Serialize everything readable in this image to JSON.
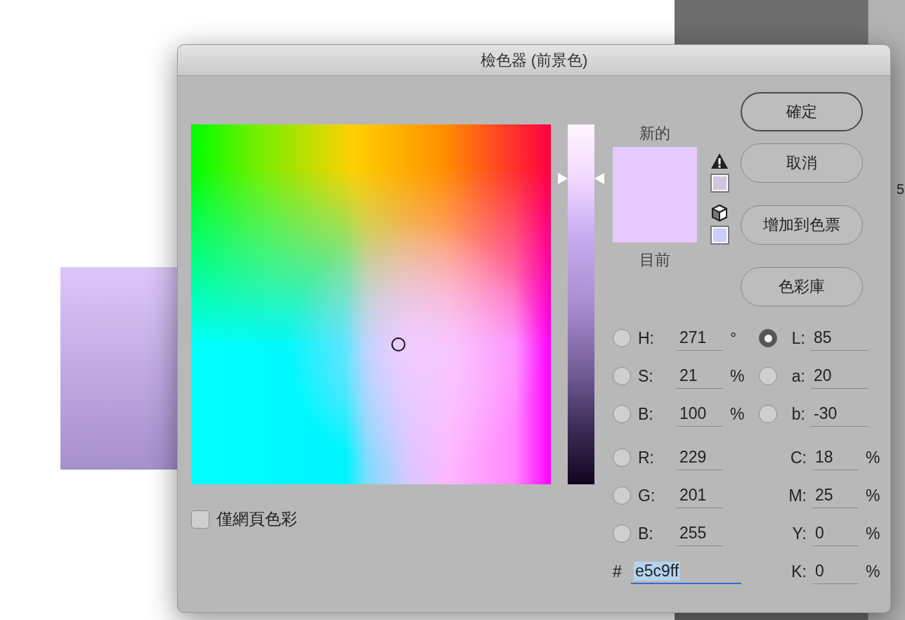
{
  "background": {
    "panel_text": "5"
  },
  "dialog": {
    "title": "檢色器 (前景色)",
    "lightness_slider": {
      "level": 0.85
    },
    "new_label": "新的",
    "current_label": "目前",
    "buttons": [
      {
        "label": "確定",
        "default": true
      },
      {
        "label": "取消",
        "default": false
      },
      {
        "label": "增加到色票",
        "default": false
      },
      {
        "label": "色彩庫",
        "default": false
      }
    ],
    "web_colors_only": {
      "label": "僅網頁色彩",
      "checked": false
    },
    "hsb": [
      {
        "label": "H:",
        "value": "271",
        "unit": "°",
        "selected": false
      },
      {
        "label": "S:",
        "value": "21",
        "unit": "%",
        "selected": false
      },
      {
        "label": "B:",
        "value": "100",
        "unit": "%",
        "selected": false
      }
    ],
    "lab": [
      {
        "label": "L:",
        "value": "85",
        "selected": true
      },
      {
        "label": "a:",
        "value": "20",
        "selected": false
      },
      {
        "label": "b:",
        "value": "-30",
        "selected": false
      }
    ],
    "rgb": [
      {
        "label": "R:",
        "value": "229",
        "selected": false
      },
      {
        "label": "G:",
        "value": "201",
        "selected": false
      },
      {
        "label": "B:",
        "value": "255",
        "selected": false
      }
    ],
    "cmyk": [
      {
        "label": "C:",
        "value": "18",
        "unit": "%"
      },
      {
        "label": "M:",
        "value": "25",
        "unit": "%"
      },
      {
        "label": "Y:",
        "value": "0",
        "unit": "%"
      },
      {
        "label": "K:",
        "value": "0",
        "unit": "%"
      }
    ],
    "hex": {
      "label": "#",
      "value": "e5c9ff",
      "highlighted": true
    }
  }
}
